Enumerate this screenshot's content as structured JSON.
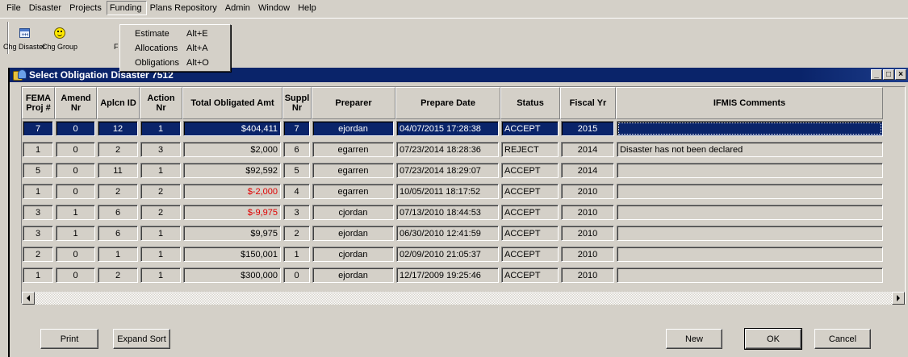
{
  "menubar": {
    "items": [
      "File",
      "Disaster",
      "Projects",
      "Funding",
      "Plans Repository",
      "Admin",
      "Window",
      "Help"
    ]
  },
  "toolbar": {
    "buttons": [
      {
        "label": "Chg Disaster",
        "icon": "calendar-icon"
      },
      {
        "label": "Chg Group",
        "icon": "smiley-icon"
      }
    ],
    "partial_label": "F"
  },
  "funding_menu": {
    "items": [
      {
        "label": "Estimate",
        "shortcut": "Alt+E"
      },
      {
        "label": "Allocations",
        "shortcut": "Alt+A"
      },
      {
        "label": "Obligations",
        "shortcut": "Alt+O"
      }
    ]
  },
  "window": {
    "title": "Select Obligation  Disaster 7512",
    "controls": [
      "_",
      "□",
      "×"
    ]
  },
  "table": {
    "headers": [
      "FEMA Proj #",
      "Amend Nr",
      "Aplcn ID",
      "Action Nr",
      "Total Obligated Amt",
      "Suppl Nr",
      "Preparer",
      "Prepare Date",
      "Status",
      "Fiscal Yr",
      "IFMIS Comments"
    ],
    "rows": [
      {
        "proj": "7",
        "amend": "0",
        "aplcn": "12",
        "action": "1",
        "amt": "$404,411",
        "suppl": "7",
        "preparer": "ejordan",
        "date": "04/07/2015 17:28:38",
        "status": "ACCEPT",
        "fy": "2015",
        "comments": "",
        "negative": false,
        "selected": true
      },
      {
        "proj": "1",
        "amend": "0",
        "aplcn": "2",
        "action": "3",
        "amt": "$2,000",
        "suppl": "6",
        "preparer": "egarren",
        "date": "07/23/2014 18:28:36",
        "status": "REJECT",
        "fy": "2014",
        "comments": "Disaster has not been declared",
        "negative": false,
        "selected": false
      },
      {
        "proj": "5",
        "amend": "0",
        "aplcn": "11",
        "action": "1",
        "amt": "$92,592",
        "suppl": "5",
        "preparer": "egarren",
        "date": "07/23/2014 18:29:07",
        "status": "ACCEPT",
        "fy": "2014",
        "comments": "",
        "negative": false,
        "selected": false
      },
      {
        "proj": "1",
        "amend": "0",
        "aplcn": "2",
        "action": "2",
        "amt": "$-2,000",
        "suppl": "4",
        "preparer": "egarren",
        "date": "10/05/2011 18:17:52",
        "status": "ACCEPT",
        "fy": "2010",
        "comments": "",
        "negative": true,
        "selected": false
      },
      {
        "proj": "3",
        "amend": "1",
        "aplcn": "6",
        "action": "2",
        "amt": "$-9,975",
        "suppl": "3",
        "preparer": "cjordan",
        "date": "07/13/2010 18:44:53",
        "status": "ACCEPT",
        "fy": "2010",
        "comments": "",
        "negative": true,
        "selected": false
      },
      {
        "proj": "3",
        "amend": "1",
        "aplcn": "6",
        "action": "1",
        "amt": "$9,975",
        "suppl": "2",
        "preparer": "ejordan",
        "date": "06/30/2010 12:41:59",
        "status": "ACCEPT",
        "fy": "2010",
        "comments": "",
        "negative": false,
        "selected": false
      },
      {
        "proj": "2",
        "amend": "0",
        "aplcn": "1",
        "action": "1",
        "amt": "$150,001",
        "suppl": "1",
        "preparer": "cjordan",
        "date": "02/09/2010 21:05:37",
        "status": "ACCEPT",
        "fy": "2010",
        "comments": "",
        "negative": false,
        "selected": false
      },
      {
        "proj": "1",
        "amend": "0",
        "aplcn": "2",
        "action": "1",
        "amt": "$300,000",
        "suppl": "0",
        "preparer": "ejordan",
        "date": "12/17/2009 19:25:46",
        "status": "ACCEPT",
        "fy": "2010",
        "comments": "",
        "negative": false,
        "selected": false
      }
    ]
  },
  "buttons": {
    "print": "Print",
    "expand_sort": "Expand Sort",
    "new": "New",
    "ok": "OK",
    "cancel": "Cancel"
  },
  "colors": {
    "selection": "#0a246a",
    "negative": "#e00000",
    "face": "#d4d0c8"
  }
}
